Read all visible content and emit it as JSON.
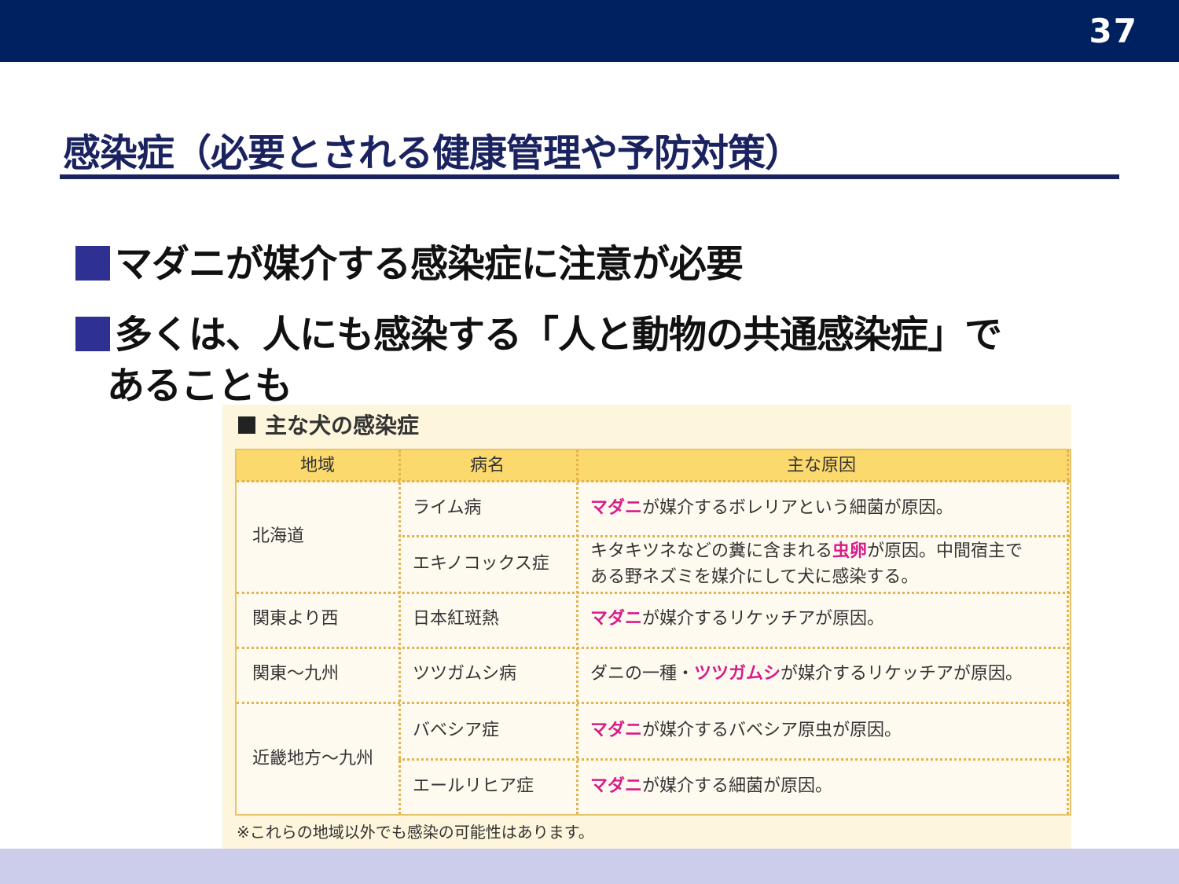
{
  "slide": {
    "page_number": "37",
    "title": "感染症（必要とされる健康管理や予防対策）",
    "bullets": [
      "マダニが媒介する感染症に注意が必要",
      "多くは、人にも感染する「人と動物の共通感染症」で"
    ],
    "bullet_continuation": "あることも"
  },
  "panel": {
    "heading": "主な犬の感染症",
    "columns": [
      "地域",
      "病名",
      "主な原因"
    ],
    "regions": [
      "北海道",
      "関東より西",
      "関東～九州",
      "近畿地方～九州"
    ],
    "rows": [
      {
        "disease": "ライム病",
        "cause_hl": "マダニ",
        "cause_rest": "が媒介するボレリアという細菌が原因。"
      },
      {
        "disease": "エキノコックス症",
        "cause_pre": "キタキツネなどの糞に含まれる",
        "cause_hl": "虫卵",
        "cause_post": "が原因。中間宿主で",
        "cause_line2": "ある野ネズミを媒介にして犬に感染する。"
      },
      {
        "disease": "日本紅斑熱",
        "cause_hl": "マダニ",
        "cause_rest": "が媒介するリケッチアが原因。"
      },
      {
        "disease": "ツツガムシ病",
        "cause_pre": "ダニの一種・",
        "cause_hl": "ツツガムシ",
        "cause_rest": "が媒介するリケッチアが原因。"
      },
      {
        "disease": "バベシア症",
        "cause_hl": "マダニ",
        "cause_rest": "が媒介するバベシア原虫が原因。"
      },
      {
        "disease": "エールリヒア症",
        "cause_hl": "マダニ",
        "cause_rest": "が媒介する細菌が原因。"
      }
    ],
    "footnote": "※これらの地域以外でも感染の可能性はあります。"
  },
  "colors": {
    "header_bar": "#00215f",
    "footer_bar": "#cccceb",
    "bullet_square": "#2e3192",
    "highlight": "#d81b8a",
    "table_header": "#fbd96d",
    "panel_bg": "#fdf6dc"
  }
}
